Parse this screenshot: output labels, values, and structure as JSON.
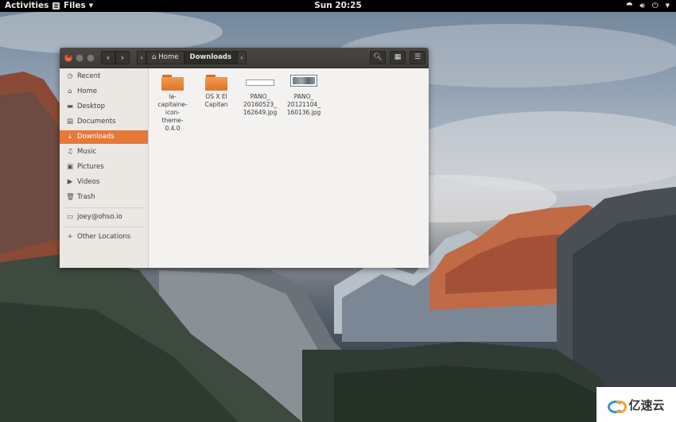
{
  "topbar": {
    "activities": "Activities",
    "app_menu": "Files",
    "clock": "Sun 20:25",
    "tray": {
      "network_icon": "network-icon",
      "volume_icon": "volume-icon",
      "power_icon": "power-icon"
    }
  },
  "window": {
    "path": {
      "home": "Home",
      "current": "Downloads"
    },
    "sidebar": {
      "items": [
        {
          "label": "Recent",
          "icon": "clock-icon"
        },
        {
          "label": "Home",
          "icon": "home-icon"
        },
        {
          "label": "Desktop",
          "icon": "desktop-icon"
        },
        {
          "label": "Documents",
          "icon": "documents-icon"
        },
        {
          "label": "Downloads",
          "icon": "download-icon",
          "active": true
        },
        {
          "label": "Music",
          "icon": "music-icon"
        },
        {
          "label": "Pictures",
          "icon": "pictures-icon"
        },
        {
          "label": "Videos",
          "icon": "videos-icon"
        },
        {
          "label": "Trash",
          "icon": "trash-icon"
        }
      ],
      "account": "joey@ohso.io",
      "other_locations": "Other Locations"
    },
    "files": [
      {
        "name": "la-capitaine-icon-theme-0.4.0",
        "lines": [
          "la-",
          "capitaine-",
          "icon-",
          "theme-",
          "0.4.0"
        ],
        "type": "folder"
      },
      {
        "name": "OS X El Capitan",
        "lines": [
          "OS X El",
          "Capitan"
        ],
        "type": "folder"
      },
      {
        "name": "PANO_20160523_162649.jpg",
        "lines": [
          "PANO_",
          "20160523_",
          "162649.jpg"
        ],
        "type": "image"
      },
      {
        "name": "PANO_20121104_160136.jpg",
        "lines": [
          "PANO_",
          "20121104_",
          "160136.jpg"
        ],
        "type": "image"
      }
    ]
  },
  "watermark": {
    "text": "亿速云"
  },
  "colors": {
    "accent": "#e4793a",
    "topbar": "#000000",
    "headerbar": "#3c3b38",
    "folder": "#e1742c"
  }
}
